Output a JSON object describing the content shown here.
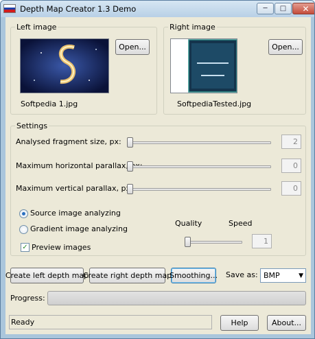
{
  "window": {
    "title": "Depth Map Creator 1.3 Demo",
    "flag_colors": [
      "#ffffff",
      "#1c3fa8",
      "#d21c1c"
    ]
  },
  "left_image": {
    "group_label": "Left image",
    "open_label": "Open...",
    "filename": "Softpedia 1.jpg"
  },
  "right_image": {
    "group_label": "Right image",
    "open_label": "Open...",
    "filename": "SoftpediaTested.jpg"
  },
  "settings": {
    "group_label": "Settings",
    "sliders": [
      {
        "label": "Analysed fragment size, px:",
        "value": "2"
      },
      {
        "label": "Maximum horizontal parallax, px:",
        "value": "0"
      },
      {
        "label": "Maximum vertical parallax, px:",
        "value": "0"
      }
    ],
    "radio_source": "Source image analyzing",
    "radio_gradient": "Gradient image analyzing",
    "selected_mode": "source",
    "preview_label": "Preview images",
    "preview_checked": true,
    "quality_label": "Quality",
    "speed_label": "Speed",
    "quality_speed_value": "1"
  },
  "actions": {
    "create_left": "Create left depth map",
    "create_right": "Create right depth map",
    "smoothing": "Smoothing...",
    "save_as_label": "Save as:",
    "save_format": "BMP"
  },
  "progress": {
    "label": "Progress:",
    "fraction": 0
  },
  "status": {
    "text": "Ready",
    "help": "Help",
    "about": "About..."
  }
}
